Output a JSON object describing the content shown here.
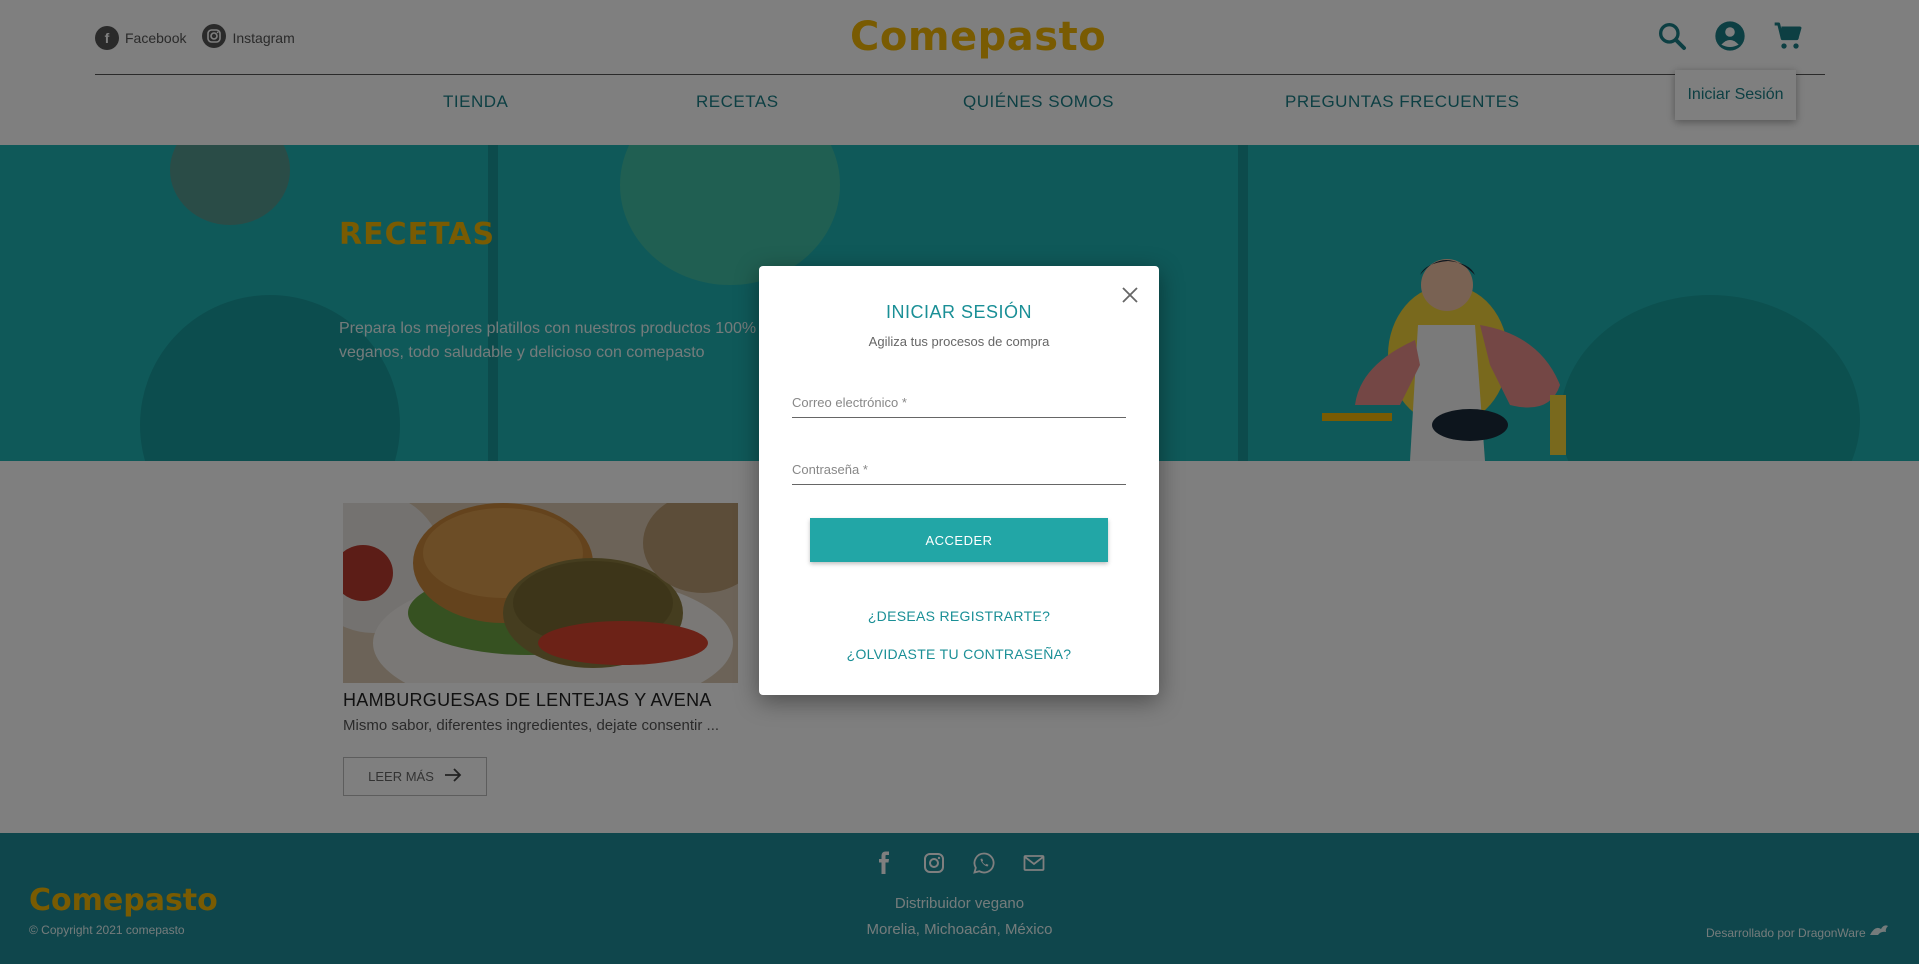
{
  "header": {
    "social": [
      {
        "icon": "facebook-icon",
        "label": "Facebook"
      },
      {
        "icon": "instagram-icon",
        "label": "Instagram"
      }
    ],
    "logo": "Comepasto",
    "icons": [
      "search-icon",
      "account-icon",
      "cart-icon"
    ],
    "nav": [
      "TIENDA",
      "RECETAS",
      "QUIÉNES SOMOS",
      "PREGUNTAS FRECUENTES"
    ],
    "dropdown_item": "Iniciar Sesión"
  },
  "hero": {
    "title": "RECETAS",
    "text": "Prepara los mejores platillos con nuestros productos 100% veganos, todo saludable y delicioso con comepasto"
  },
  "card": {
    "title": "HAMBURGUESAS DE LENTEJAS Y AVENA",
    "description": "Mismo sabor, diferentes ingredientes, dejate consentir ...",
    "button": "LEER MÁS"
  },
  "footer": {
    "icons": [
      "facebook-icon",
      "instagram-icon",
      "whatsapp-icon",
      "mail-icon"
    ],
    "logo": "Comepasto",
    "copyright": "© Copyright 2021 comepasto",
    "tagline": "Distribuidor vegano",
    "location": "Morelia, Michoacán, México",
    "developer": "Desarrollado por DragonWare"
  },
  "modal": {
    "title": "INICIAR SESIÓN",
    "subtitle": "Agiliza tus procesos de compra",
    "email_placeholder": "Correo electrónico *",
    "password_placeholder": "Contraseña *",
    "submit": "ACCEDER",
    "register_link": "¿DESEAS REGISTRARTE?",
    "forgot_link": "¿OLVIDASTE TU CONTRASEÑA?"
  },
  "colors": {
    "brand_yellow": "#f2b705",
    "teal": "#1fb3b3",
    "teal_dark": "#1a8f96",
    "footer_bg": "#1f8d99"
  }
}
